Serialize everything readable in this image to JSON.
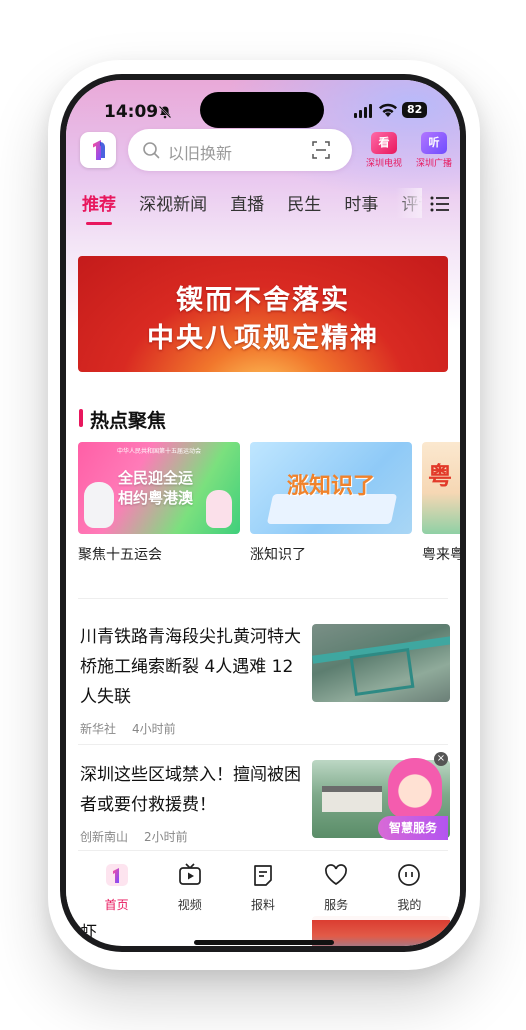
{
  "status_bar": {
    "time": "14:09",
    "battery": "82"
  },
  "header": {
    "search_placeholder": "以旧换新",
    "tv": {
      "icon_text": "看",
      "label": "深圳电视"
    },
    "radio": {
      "icon_text": "听",
      "label": "深圳广播"
    }
  },
  "tabs": [
    {
      "label": "推荐"
    },
    {
      "label": "深视新闻"
    },
    {
      "label": "直播"
    },
    {
      "label": "民生"
    },
    {
      "label": "时事"
    },
    {
      "label": "评论"
    }
  ],
  "banner": {
    "line1": "锲而不舍落实",
    "line2": "中央八项规定精神"
  },
  "hot_section": {
    "title": "热点聚焦",
    "cards": [
      {
        "label": "聚焦十五运会",
        "image_text": "全民迎全运 相约粤港澳",
        "header_text": "中华人民共和国第十五届运动会"
      },
      {
        "label": "涨知识了",
        "image_text": "涨知识了"
      },
      {
        "label": "粤来粤",
        "image_text": "粤"
      }
    ]
  },
  "news": [
    {
      "title": "川青铁路青海段尖扎黄河特大桥施工绳索断裂 4人遇难 12人失联",
      "source": "新华社",
      "time": "4小时前"
    },
    {
      "title": "深圳这些区域禁入！擅闯被困者或要付救援费！",
      "source": "创新南山",
      "time": "2小时前"
    },
    {
      "title": "虾"
    }
  ],
  "ai_assistant": {
    "label": "智慧服务",
    "close": "×"
  },
  "bottom_nav": [
    {
      "label": "首页",
      "icon": "home-icon"
    },
    {
      "label": "视频",
      "icon": "video-icon"
    },
    {
      "label": "报料",
      "icon": "report-icon"
    },
    {
      "label": "服务",
      "icon": "heart-icon"
    },
    {
      "label": "我的",
      "icon": "profile-icon"
    }
  ],
  "colors": {
    "accent": "#e8175d",
    "banner_red": "#d92a22"
  }
}
